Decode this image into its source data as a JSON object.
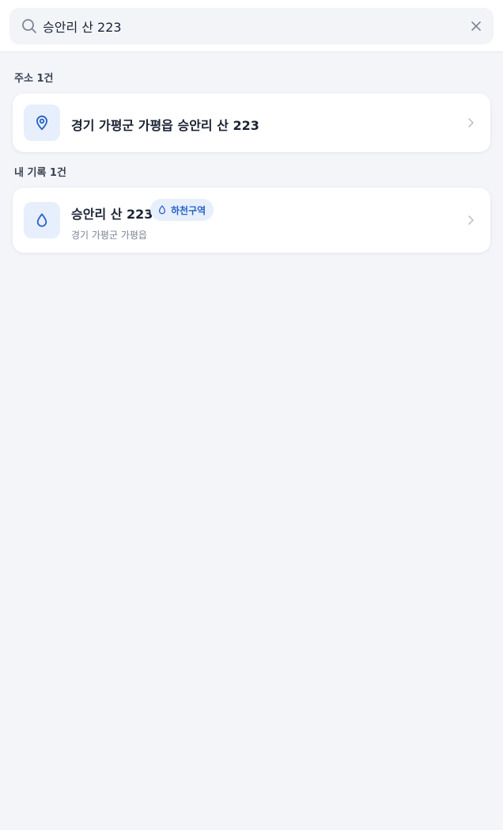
{
  "search": {
    "value": "승안리 산 223",
    "placeholder": ""
  },
  "sections": {
    "address": {
      "label": "주소 1건",
      "item": {
        "title": "경기 가평군 가평읍 승안리 산 223",
        "icon": "location-pin-icon"
      }
    },
    "records": {
      "label": "내 기록 1건",
      "item": {
        "title": "승안리 산 223",
        "subtitle": "경기 가평군 가평읍",
        "badge": "하천구역",
        "icon": "water-drop-icon"
      }
    }
  },
  "colors": {
    "background": "#f3f5f9",
    "accent": "#2461c8",
    "icon_bg": "#e7effc"
  }
}
